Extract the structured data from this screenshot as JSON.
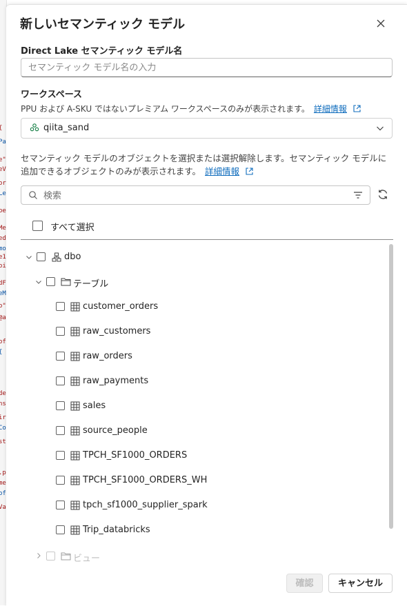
{
  "background_fragments": [
    "{ \"",
    "Pa",
    "e\"",
    "eV",
    "or",
    "Le",
    "pe",
    "Me",
    "ed",
    "mo",
    "e1",
    "oi",
    "dF",
    "eM",
    "o\"",
    "@a",
    "of",
    "{",
    "de",
    "ns",
    "ir",
    "Co",
    "st",
    ".p",
    "me",
    "of",
    "Va"
  ],
  "dialog": {
    "title": "新しいセマンティック モデル",
    "close_label": "×"
  },
  "name_field": {
    "label": "Direct Lake セマンティック モデル名",
    "placeholder": "セマンティック モデル名の入力",
    "value": ""
  },
  "workspace": {
    "label": "ワークスペース",
    "description": "PPU および A-SKU ではないプレミアム ワークスペースのみが表示されます。",
    "link_label": "詳細情報",
    "selected": "qiita_sand"
  },
  "objects": {
    "description_line1": "セマンティック モデルのオブジェクトを選択または選択解除します。セマンティック モデルに",
    "description_line2": "追加できるオブジェクトのみが表示されます。",
    "link_label": "詳細情報"
  },
  "search": {
    "placeholder": "検索"
  },
  "select_all_label": "すべて選択",
  "tree": {
    "schema": "dbo",
    "tables_folder": "テーブル",
    "tables": [
      "customer_orders",
      "raw_customers",
      "raw_orders",
      "raw_payments",
      "sales",
      "source_people",
      "TPCH_SF1000_ORDERS",
      "TPCH_SF1000_ORDERS_WH",
      "tpch_sf1000_supplier_spark",
      "Trip_databricks"
    ],
    "views_folder": "ビュー"
  },
  "footer": {
    "confirm_label": "確認",
    "cancel_label": "キャンセル"
  }
}
